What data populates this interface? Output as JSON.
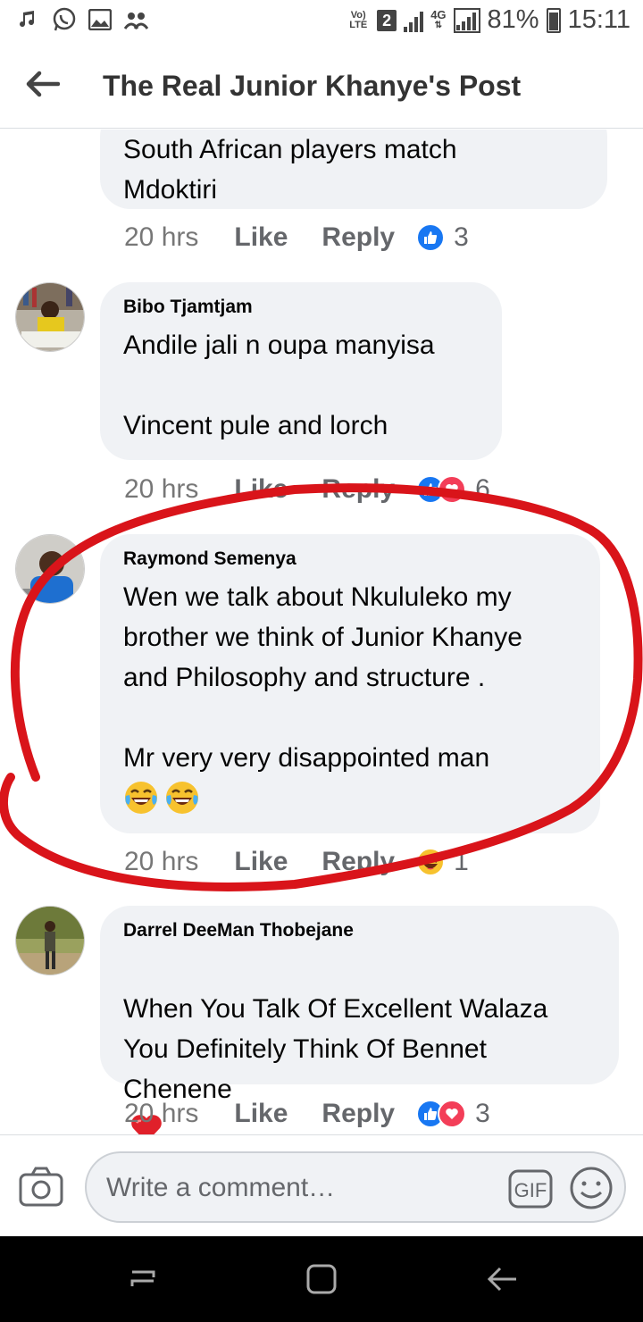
{
  "status_bar": {
    "volte_top": "Vo)",
    "volte_bottom": "LTE",
    "sim": "2",
    "net_type": "4G",
    "battery": "81%",
    "time": "15:11"
  },
  "header": {
    "title": "The Real Junior Khanye's Post"
  },
  "comments": [
    {
      "author": "",
      "text": "South African players match\nMdoktiri",
      "time": "20 hrs",
      "like": "Like",
      "reply": "Reply",
      "reactions": [
        "like"
      ],
      "count": "3"
    },
    {
      "author": "Bibo Tjamtjam",
      "text": "Andile jali n oupa manyisa\n\nVincent pule and lorch",
      "time": "20 hrs",
      "like": "Like",
      "reply": "Reply",
      "reactions": [
        "like",
        "love"
      ],
      "count": "6"
    },
    {
      "author": "Raymond Semenya",
      "text": "Wen we talk about Nkululeko my\nbrother we think of Junior Khanye\nand Philosophy and  structure  .\n\nMr very very disappointed man",
      "emoji": [
        "tears-of-joy",
        "tears-of-joy"
      ],
      "time": "20 hrs",
      "like": "Like",
      "reply": "Reply",
      "reactions": [
        "haha"
      ],
      "count": "1"
    },
    {
      "author": "Darrel DeeMan Thobejane",
      "text": "When You Talk Of Excellent Walaza\nYou Definitely Think Of Bennet\nChenene",
      "emoji": [
        "red-heart"
      ],
      "time": "20 hrs",
      "like": "Like",
      "reply": "Reply",
      "reactions": [
        "like",
        "love"
      ],
      "count": "3"
    }
  ],
  "composer": {
    "placeholder": "Write a comment…",
    "gif_label": "GIF"
  },
  "colors": {
    "like_blue": "#1877f2",
    "love_red": "#f33e58",
    "annotation_red": "#d9141a",
    "bubble_bg": "#f0f2f5"
  }
}
